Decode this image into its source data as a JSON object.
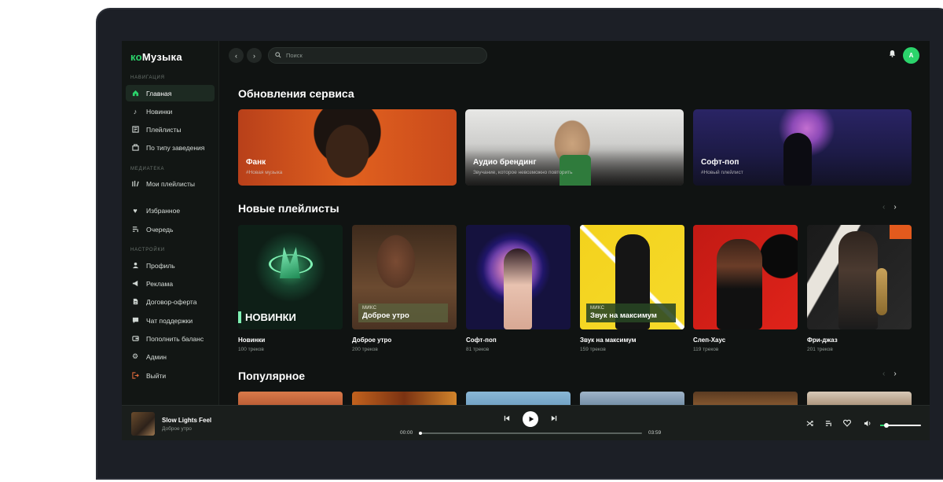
{
  "app": {
    "logo_part1": "ко",
    "logo_part2": "Музыка"
  },
  "sidebar": {
    "section_nav": "Навигация",
    "section_library": "Медиатека",
    "section_settings": "Настройки",
    "nav_items": [
      {
        "label": "Главная",
        "icon": "home-icon"
      },
      {
        "label": "Новинки",
        "icon": "music-note-icon"
      },
      {
        "label": "Плейлисты",
        "icon": "playlist-icon"
      },
      {
        "label": "По типу заведения",
        "icon": "venue-icon"
      }
    ],
    "library_items": [
      {
        "label": "Мои плейлисты",
        "icon": "library-icon"
      },
      {
        "label": "Избранное",
        "icon": "heart-icon"
      },
      {
        "label": "Очередь",
        "icon": "queue-icon"
      }
    ],
    "settings_items": [
      {
        "label": "Профиль",
        "icon": "user-icon"
      },
      {
        "label": "Реклама",
        "icon": "megaphone-icon"
      },
      {
        "label": "Договор-оферта",
        "icon": "document-icon"
      },
      {
        "label": "Чат поддержки",
        "icon": "chat-icon"
      },
      {
        "label": "Пополнить баланс",
        "icon": "wallet-icon"
      },
      {
        "label": "Админ",
        "icon": "gear-icon"
      },
      {
        "label": "Выйти",
        "icon": "logout-icon"
      }
    ]
  },
  "topbar": {
    "search_placeholder": "Поиск",
    "avatar_letter": "А"
  },
  "updates": {
    "title": "Обновления сервиса",
    "cards": [
      {
        "title": "Фанк",
        "subtitle": "#Новая музыка"
      },
      {
        "title": "Аудио брендинг",
        "subtitle": "Звучание, которое невозможно повторить"
      },
      {
        "title": "Софт-поп",
        "subtitle": "#Новый плейлист"
      }
    ]
  },
  "new_playlists": {
    "title": "Новые плейлисты",
    "items": [
      {
        "name": "Новинки",
        "count": "100 треков",
        "art_text": "НОВИНКИ"
      },
      {
        "name": "Доброе утро",
        "count": "200 треков",
        "mix": "МИКС",
        "mix_title": "Доброе утро"
      },
      {
        "name": "Софт-поп",
        "count": "81 треков"
      },
      {
        "name": "Звук на максимум",
        "count": "159 треков",
        "mix": "МИКС",
        "mix_title": "Звук на максимум"
      },
      {
        "name": "Слеп-Хаус",
        "count": "119 треков"
      },
      {
        "name": "Фри-джаз",
        "count": "201 треков"
      }
    ]
  },
  "popular": {
    "title": "Популярное"
  },
  "player": {
    "track_title": "Slow Lights Feel",
    "track_subtitle": "Доброе утро",
    "time_current": "00:00",
    "time_total": "03:59",
    "progress": 0.0,
    "volume": 0.15
  },
  "colors": {
    "accent": "#2bd46b",
    "background": "#101312",
    "sidebar": "#121614",
    "player": "#1a1e1c"
  }
}
